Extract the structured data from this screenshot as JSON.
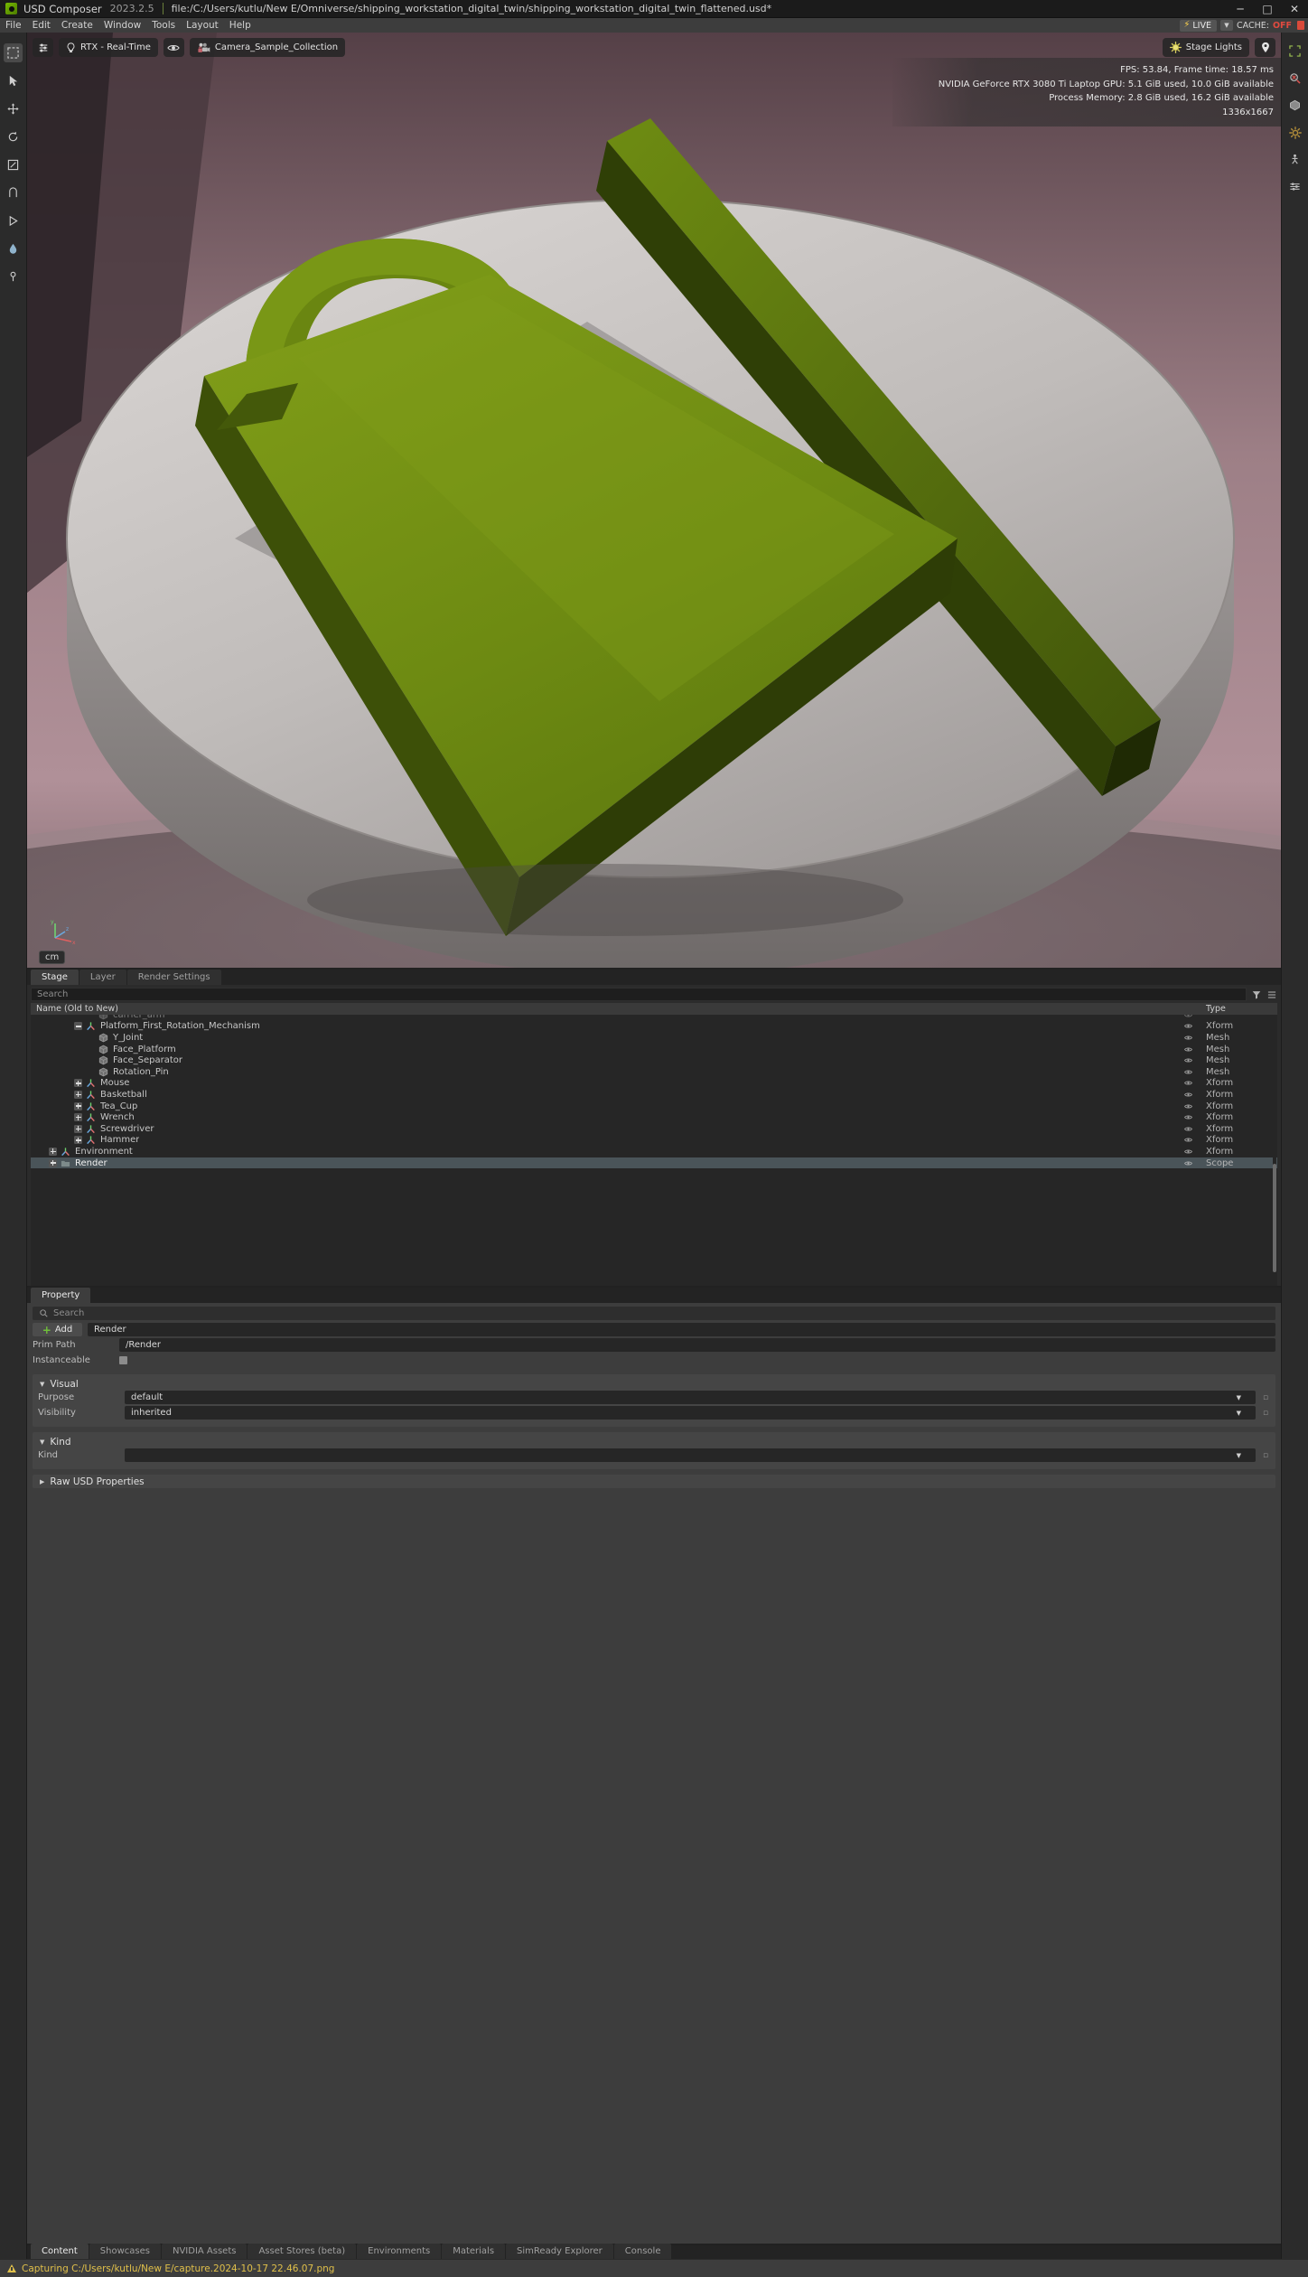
{
  "titlebar": {
    "app_name": "USD Composer",
    "version": "2023.2.5",
    "file_path": "file:/C:/Users/kutlu/New E/Omniverse/shipping_workstation_digital_twin/shipping_workstation_digital_twin_flattened.usd*",
    "minimize": "─",
    "maximize": "□",
    "close": "✕"
  },
  "menubar": {
    "items": [
      "File",
      "Edit",
      "Create",
      "Window",
      "Tools",
      "Layout",
      "Help"
    ],
    "live_label": "LIVE",
    "live_bolt": "⚡",
    "cache_label": "CACHE:",
    "cache_value": "OFF"
  },
  "viewport": {
    "settings_button": "viewport-settings-icon",
    "renderer": "RTX - Real-Time",
    "eye_button": "visibility-icon",
    "camera": "Camera_Sample_Collection",
    "stage_lights": "Stage Lights",
    "marker_button": "light-marker-icon",
    "stats": [
      "FPS: 53.84, Frame time: 18.57 ms",
      "NVIDIA GeForce RTX 3080 Ti Laptop GPU: 5.1 GiB used, 10.0 GiB available",
      "Process Memory: 2.8 GiB used, 16.2 GiB available",
      "1336x1667"
    ],
    "unit": "cm"
  },
  "stage": {
    "tabs": [
      {
        "label": "Stage",
        "active": true
      },
      {
        "label": "Layer",
        "active": false
      },
      {
        "label": "Render Settings",
        "active": false
      }
    ],
    "search_placeholder": "Search",
    "columns": {
      "name": "Name (Old to New)",
      "type": "Type"
    },
    "rows": [
      {
        "label": "carrier_arm",
        "type": "",
        "indent": 4,
        "icon": "mesh",
        "expander": "none",
        "selected": false,
        "faded": true,
        "clipped": true
      },
      {
        "label": "Platform_First_Rotation_Mechanism",
        "type": "Xform",
        "indent": 3,
        "icon": "xform",
        "expander": "minus",
        "selected": false
      },
      {
        "label": "Y_Joint",
        "type": "Mesh",
        "indent": 4,
        "icon": "mesh",
        "expander": "none",
        "selected": false
      },
      {
        "label": "Face_Platform",
        "type": "Mesh",
        "indent": 4,
        "icon": "mesh",
        "expander": "none",
        "selected": false
      },
      {
        "label": "Face_Separator",
        "type": "Mesh",
        "indent": 4,
        "icon": "mesh",
        "expander": "none",
        "selected": false
      },
      {
        "label": "Rotation_Pin",
        "type": "Mesh",
        "indent": 4,
        "icon": "mesh",
        "expander": "none",
        "selected": false
      },
      {
        "label": "Mouse",
        "type": "Xform",
        "indent": 3,
        "icon": "xform",
        "expander": "plus",
        "selected": false
      },
      {
        "label": "Basketball",
        "type": "Xform",
        "indent": 3,
        "icon": "xform",
        "expander": "plus",
        "selected": false
      },
      {
        "label": "Tea_Cup",
        "type": "Xform",
        "indent": 3,
        "icon": "xform",
        "expander": "plus",
        "selected": false
      },
      {
        "label": "Wrench",
        "type": "Xform",
        "indent": 3,
        "icon": "xform",
        "expander": "plus",
        "selected": false
      },
      {
        "label": "Screwdriver",
        "type": "Xform",
        "indent": 3,
        "icon": "xform",
        "expander": "plus",
        "selected": false
      },
      {
        "label": "Hammer",
        "type": "Xform",
        "indent": 3,
        "icon": "xform",
        "expander": "plus",
        "selected": false
      },
      {
        "label": "Environment",
        "type": "Xform",
        "indent": 1,
        "icon": "xform",
        "expander": "plus",
        "selected": false
      },
      {
        "label": "Render",
        "type": "Scope",
        "indent": 1,
        "icon": "scope",
        "expander": "plus",
        "selected": true
      }
    ]
  },
  "property": {
    "tab": "Property",
    "search_placeholder": "Search",
    "add_label": "Add",
    "name_value": "Render",
    "prim_path_label": "Prim Path",
    "prim_path_value": "/Render",
    "instanceable_label": "Instanceable",
    "visual": {
      "title": "Visual",
      "purpose_label": "Purpose",
      "purpose_value": "default",
      "visibility_label": "Visibility",
      "visibility_value": "inherited"
    },
    "kind": {
      "title": "Kind",
      "kind_label": "Kind",
      "kind_value": ""
    },
    "raw_usd_title": "Raw USD Properties"
  },
  "bottom_tabs": [
    {
      "label": "Content",
      "active": true
    },
    {
      "label": "Showcases",
      "active": false
    },
    {
      "label": "NVIDIA Assets",
      "active": false
    },
    {
      "label": "Asset Stores (beta)",
      "active": false
    },
    {
      "label": "Environments",
      "active": false
    },
    {
      "label": "Materials",
      "active": false
    },
    {
      "label": "SimReady Explorer",
      "active": false
    },
    {
      "label": "Console",
      "active": false
    }
  ],
  "statusbar": {
    "message": "Capturing C:/Users/kutlu/New E/capture.2024-10-17 22.46.07.png"
  },
  "colors": {
    "accent_green": "#76b900",
    "warning": "#e0c04a",
    "error": "#e04a3f",
    "selection": "#4a5459"
  }
}
